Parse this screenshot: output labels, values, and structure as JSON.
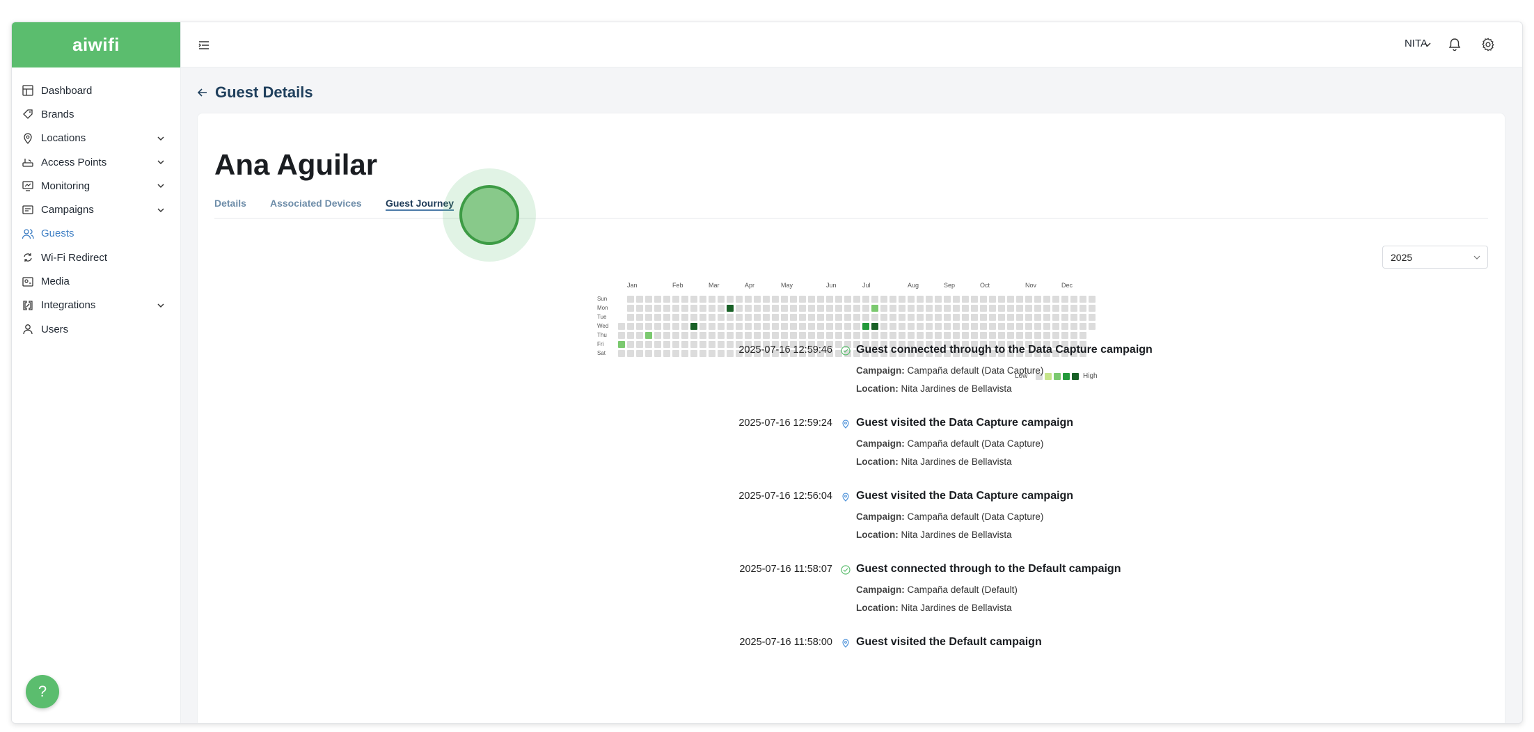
{
  "brand": {
    "logo_text": "aiwifi",
    "accent": "#5bbd6e"
  },
  "sidebar": {
    "items": [
      {
        "label": "Dashboard",
        "icon": "dashboard-icon",
        "expandable": false
      },
      {
        "label": "Brands",
        "icon": "brands-icon",
        "expandable": false
      },
      {
        "label": "Locations",
        "icon": "location-pin-icon",
        "expandable": true
      },
      {
        "label": "Access Points",
        "icon": "router-icon",
        "expandable": true
      },
      {
        "label": "Monitoring",
        "icon": "monitor-icon",
        "expandable": true
      },
      {
        "label": "Campaigns",
        "icon": "campaign-icon",
        "expandable": true
      },
      {
        "label": "Guests",
        "icon": "guests-icon",
        "expandable": false,
        "active": true
      },
      {
        "label": "Wi-Fi Redirect",
        "icon": "redirect-icon",
        "expandable": false
      },
      {
        "label": "Media",
        "icon": "media-icon",
        "expandable": false
      },
      {
        "label": "Integrations",
        "icon": "integrations-icon",
        "expandable": true
      },
      {
        "label": "Users",
        "icon": "user-icon",
        "expandable": false
      }
    ]
  },
  "topbar": {
    "user_name": "NITA"
  },
  "page": {
    "title": "Guest Details"
  },
  "guest": {
    "name": "Ana Aguilar"
  },
  "tabs": [
    {
      "label": "Details",
      "active": false
    },
    {
      "label": "Associated Devices",
      "active": false
    },
    {
      "label": "Guest Journey",
      "active": true
    }
  ],
  "year_select": {
    "value": "2025"
  },
  "heatmap": {
    "months": [
      "Jan",
      "Feb",
      "Mar",
      "Apr",
      "May",
      "Jun",
      "Jul",
      "Aug",
      "Sep",
      "Oct",
      "Nov",
      "Dec"
    ],
    "days": [
      "Sun",
      "Mon",
      "Tue",
      "Wed",
      "Thu",
      "Fri",
      "Sat"
    ],
    "legend_low": "Low",
    "legend_high": "High",
    "colors": [
      "#dcdcdc",
      "#c6e48b",
      "#7bc96f",
      "#239a3b",
      "#196127"
    ],
    "activity": [
      {
        "week": 0,
        "day": 5,
        "level": 2
      },
      {
        "week": 3,
        "day": 4,
        "level": 2
      },
      {
        "week": 8,
        "day": 3,
        "level": 4
      },
      {
        "week": 12,
        "day": 1,
        "level": 4
      },
      {
        "week": 27,
        "day": 3,
        "level": 3
      },
      {
        "week": 28,
        "day": 1,
        "level": 2
      },
      {
        "week": 28,
        "day": 3,
        "level": 4
      }
    ]
  },
  "events": [
    {
      "time": "2025-07-16 12:59:46",
      "type": "connected",
      "title": "Guest connected through to the Data Capture campaign",
      "campaign_label": "Campaign:",
      "campaign": "Campaña default (Data Capture)",
      "location_label": "Location:",
      "location": "Nita Jardines de Bellavista"
    },
    {
      "time": "2025-07-16 12:59:24",
      "type": "visited",
      "title": "Guest visited the Data Capture campaign",
      "campaign_label": "Campaign:",
      "campaign": "Campaña default (Data Capture)",
      "location_label": "Location:",
      "location": "Nita Jardines de Bellavista"
    },
    {
      "time": "2025-07-16 12:56:04",
      "type": "visited",
      "title": "Guest visited the Data Capture campaign",
      "campaign_label": "Campaign:",
      "campaign": "Campaña default (Data Capture)",
      "location_label": "Location:",
      "location": "Nita Jardines de Bellavista"
    },
    {
      "time": "2025-07-16 11:58:07",
      "type": "connected",
      "title": "Guest connected through to the Default campaign",
      "campaign_label": "Campaign:",
      "campaign": "Campaña default (Default)",
      "location_label": "Location:",
      "location": "Nita Jardines de Bellavista"
    },
    {
      "time": "2025-07-16 11:58:00",
      "type": "visited",
      "title": "Guest visited the Default campaign"
    }
  ],
  "help": {
    "label": "?"
  }
}
